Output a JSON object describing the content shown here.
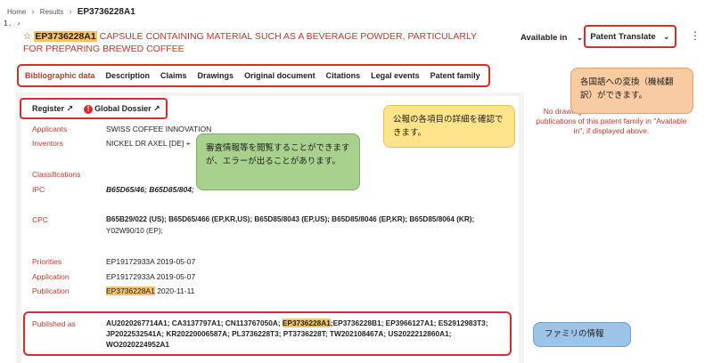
{
  "breadcrumb": {
    "home": "Home",
    "results": "Results",
    "current": "EP3736228A1"
  },
  "result_index": "1.",
  "header": {
    "pub_number": "EP3736228A1",
    "title_text": " CAPSULE CONTAINING MATERIAL SUCH AS A BEVERAGE POWDER, PARTICULARLY FOR PREPARING BREWED COFFEE",
    "available_in": "Available in",
    "translate_label": "Patent Translate"
  },
  "tabs": [
    "Bibliographic data",
    "Description",
    "Claims",
    "Drawings",
    "Original document",
    "Citations",
    "Legal events",
    "Patent family"
  ],
  "links": {
    "register": "Register ↗",
    "dossier": "Global Dossier ↗"
  },
  "biblio": {
    "applicants_label": "Applicants",
    "applicants_value": "SWISS COFFEE INNOVATION",
    "inventors_label": "Inventors",
    "inventors_value": "NICKEL DR AXEL [DE]  +",
    "classifications_label": "Classifications",
    "ipc_label": "IPC",
    "ipc_value": "B65D65/46; B65D85/804;",
    "cpc_label": "CPC",
    "cpc_value_1": "B65B29/022 (US); B65D65/466 (EP,KR,US); B65D85/8043 (EP,US); B65D85/8046 (EP,KR); B65D85/8064 (KR);",
    "cpc_value_2": "Y02W90/10 (EP);",
    "priorities_label": "Priorities",
    "priorities_value": "EP19172933A 2019-05-07",
    "application_label": "Application",
    "application_value": "EP19172933A 2019-05-07",
    "publication_label": "Publication",
    "publication_number": "EP3736228A1",
    "publication_date": " 2020-11-11"
  },
  "published_as": {
    "label": "Published as",
    "line1_a": "AU2020267714A1; CA3137797A1; CN113767050A; ",
    "line1_hl": "EP3736228A1",
    "line1_b": ";EP3736228B1; EP3966127A1; ES2912983T3;",
    "line2": "JP2022532541A; KR20220006587A; PL3736228T3; PT3736228T; TW202108467A; US2022212860A1;",
    "line3": "WO2020224952A1"
  },
  "side_note": "No drawings found. Please consult other publications of this patent family in \"Available in\", if displayed above.",
  "callouts": {
    "translate": "各国語への変換（機械翻訳）ができます。",
    "tabs": "公報の各項目の詳細を確認できます。",
    "dossier": "審査情報等を閲覧することができますが、エラーが出ることがあります。",
    "family": "ファミリの情報"
  },
  "colors": {
    "accent_red": "#c0392b",
    "box_red": "#d92b2b",
    "highlight": "#f5c26b"
  }
}
